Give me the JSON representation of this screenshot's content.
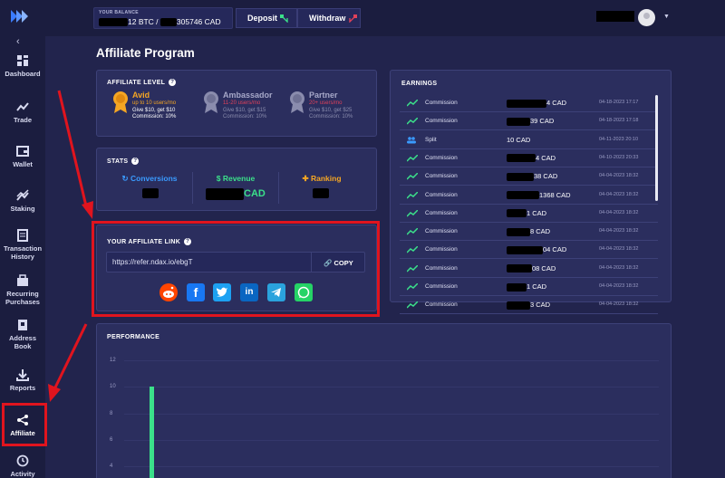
{
  "topbar": {
    "balance_label": "YOUR BALANCE",
    "btc_suffix": "12 BTC /",
    "cad_suffix": "305746 CAD",
    "deposit_label": "Deposit",
    "withdraw_label": "Withdraw"
  },
  "sidebar": {
    "items": [
      {
        "label": "Dashboard",
        "icon": "dashboard-icon"
      },
      {
        "label": "Trade",
        "icon": "trade-icon"
      },
      {
        "label": "Wallet",
        "icon": "wallet-icon"
      },
      {
        "label": "Staking",
        "icon": "staking-icon"
      },
      {
        "label": "Transaction\nHistory",
        "l1": "Transaction",
        "l2": "History",
        "icon": "history-icon"
      },
      {
        "label": "Recurring\nPurchases",
        "l1": "Recurring",
        "l2": "Purchases",
        "icon": "recurring-icon"
      },
      {
        "label": "Address\nBook",
        "l1": "Address",
        "l2": "Book",
        "icon": "address-book-icon"
      },
      {
        "label": "Reports",
        "icon": "reports-icon"
      },
      {
        "label": "Affiliate",
        "icon": "share-icon"
      },
      {
        "label": "Activity",
        "icon": "activity-icon"
      }
    ]
  },
  "page": {
    "title": "Affiliate Program"
  },
  "affiliate_level": {
    "title": "AFFILIATE LEVEL",
    "levels": [
      {
        "name": "Avid",
        "users": "up to 10 users/mo",
        "give": "Give $10, get $10",
        "commission": "Commission: 10%",
        "color": "#f5a623",
        "active": true
      },
      {
        "name": "Ambassador",
        "users": "11-20 users/mo",
        "give": "Give $10, get $15",
        "commission": "Commission: 10%",
        "color": "#e0415a",
        "active": false
      },
      {
        "name": "Partner",
        "users": "20+ users/mo",
        "give": "Give $10, get $25",
        "commission": "Commission: 10%",
        "color": "#e0415a",
        "active": false
      }
    ]
  },
  "stats": {
    "title": "STATS",
    "conversions_label": "Conversions",
    "revenue_label": "Revenue",
    "revenue_unit": "CAD",
    "ranking_label": "Ranking"
  },
  "affiliate_link": {
    "title": "YOUR AFFILIATE LINK",
    "url": "https://refer.ndax.io/ebgT",
    "copy_label": "COPY",
    "share": [
      "reddit-icon",
      "facebook-icon",
      "twitter-icon",
      "linkedin-icon",
      "telegram-icon",
      "whatsapp-icon"
    ]
  },
  "earnings": {
    "title": "EARNINGS",
    "rows": [
      {
        "type": "Commission",
        "amount": "4 CAD",
        "date": "04-18-2023 17:17",
        "icon": "trend-icon"
      },
      {
        "type": "Commission",
        "amount": "39 CAD",
        "date": "04-18-2023 17:18",
        "icon": "trend-icon"
      },
      {
        "type": "Split",
        "amount": "10 CAD",
        "date": "04-11-2023 20:10",
        "icon": "split-icon"
      },
      {
        "type": "Commission",
        "amount": "4 CAD",
        "date": "04-10-2023 20:33",
        "icon": "trend-icon"
      },
      {
        "type": "Commission",
        "amount": "38 CAD",
        "date": "04-04-2023 18:32",
        "icon": "trend-icon"
      },
      {
        "type": "Commission",
        "amount": "1368 CAD",
        "date": "04-04-2023 18:32",
        "icon": "trend-icon"
      },
      {
        "type": "Commission",
        "amount": "1 CAD",
        "date": "04-04-2023 18:32",
        "icon": "trend-icon"
      },
      {
        "type": "Commission",
        "amount": "8 CAD",
        "date": "04-04-2023 18:32",
        "icon": "trend-icon"
      },
      {
        "type": "Commission",
        "amount": "04 CAD",
        "date": "04-04-2023 18:32",
        "icon": "trend-icon"
      },
      {
        "type": "Commission",
        "amount": "08 CAD",
        "date": "04-04-2023 18:32",
        "icon": "trend-icon"
      },
      {
        "type": "Commission",
        "amount": "1 CAD",
        "date": "04-04-2023 18:32",
        "icon": "trend-icon"
      },
      {
        "type": "Commission",
        "amount": "3 CAD",
        "date": "04-04-2023 18:32",
        "icon": "trend-icon"
      }
    ]
  },
  "performance": {
    "title": "PERFORMANCE"
  },
  "chart_data": {
    "type": "bar",
    "yticks": [
      "12",
      "10",
      "8",
      "6",
      "4"
    ],
    "ylim": [
      0,
      12
    ],
    "series": [
      {
        "values": [
          10
        ]
      }
    ]
  },
  "colors": {
    "accent_green": "#3be08a",
    "highlight_red": "#e0141e",
    "panel_bg": "#2b2e5e"
  }
}
